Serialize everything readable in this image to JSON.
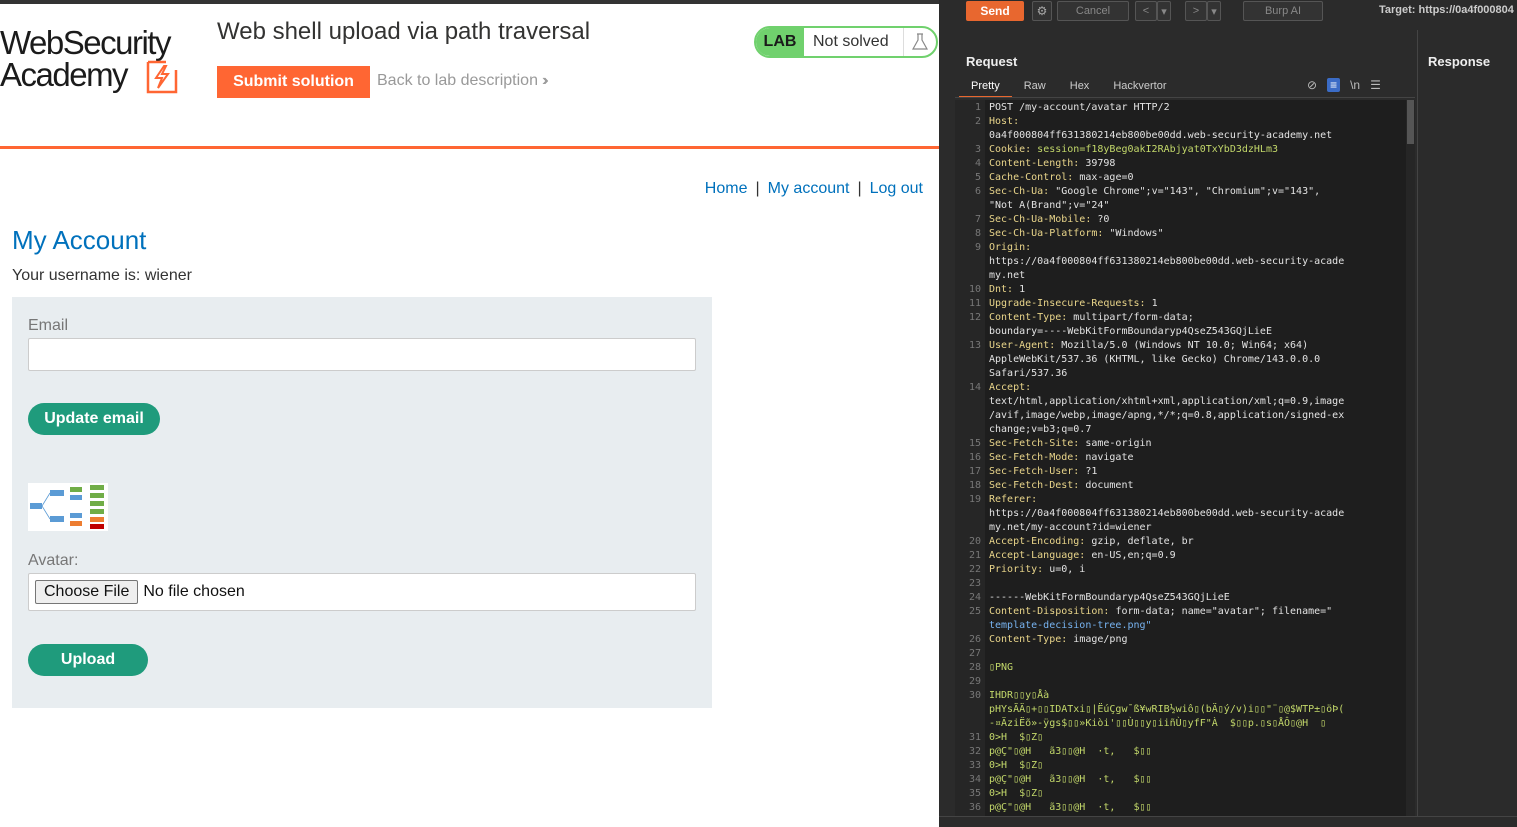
{
  "browser": {
    "logo": {
      "line1": "WebSecurity",
      "line2": "Academy"
    },
    "lab_title": "Web shell upload via path traversal",
    "submit_label": "Submit solution",
    "back_label": "Back to lab description",
    "lab_badge": {
      "tag": "LAB",
      "status": "Not solved"
    },
    "nav": {
      "home": "Home",
      "sep": "|",
      "account": "My account",
      "logout": "Log out"
    },
    "heading": "My Account",
    "username_line": "Your username is: wiener",
    "form": {
      "email_label": "Email",
      "email_value": "",
      "update_label": "Update email",
      "avatar_label": "Avatar:",
      "choose_file": "Choose File",
      "no_file": "No file chosen",
      "upload_label": "Upload"
    }
  },
  "burp": {
    "toolbar": {
      "send": "Send",
      "cancel": "Cancel",
      "burp_ai": "Burp AI",
      "target": "Target: https://0a4f000804"
    },
    "request_title": "Request",
    "response_title": "Response",
    "tabs": [
      "Pretty",
      "Raw",
      "Hex",
      "Hackvertor"
    ],
    "newline_toggle": "\\n",
    "lines": [
      {
        "n": "1",
        "k": "POST /my-account/avatar HTTP/2",
        "v": "",
        "kc": "hv"
      },
      {
        "n": "2",
        "k": "Host:",
        "v": "",
        "kc": "hk"
      },
      {
        "n": "",
        "k": "0a4f000804ff631380214eb800be00dd.web-security-academy.net",
        "v": "",
        "kc": "hv"
      },
      {
        "n": "3",
        "k": "Cookie: ",
        "v": "session=f18yBeg0akI2RAbjyat0TxYbD3dzHLm3",
        "kc": "hk",
        "vc": "gr"
      },
      {
        "n": "4",
        "k": "Content-Length:",
        "v": " 39798",
        "kc": "hk"
      },
      {
        "n": "5",
        "k": "Cache-Control:",
        "v": " max-age=0",
        "kc": "hk"
      },
      {
        "n": "6",
        "k": "Sec-Ch-Ua:",
        "v": " \"Google Chrome\";v=\"143\", \"Chromium\";v=\"143\",",
        "kc": "hk"
      },
      {
        "n": "",
        "k": "\"Not A(Brand\";v=\"24\"",
        "v": "",
        "kc": "hv"
      },
      {
        "n": "7",
        "k": "Sec-Ch-Ua-Mobile:",
        "v": " ?0",
        "kc": "hk"
      },
      {
        "n": "8",
        "k": "Sec-Ch-Ua-Platform:",
        "v": " \"Windows\"",
        "kc": "hk"
      },
      {
        "n": "9",
        "k": "Origin:",
        "v": "",
        "kc": "hk"
      },
      {
        "n": "",
        "k": "https://0a4f000804ff631380214eb800be00dd.web-security-acade",
        "v": "",
        "kc": "hv"
      },
      {
        "n": "",
        "k": "my.net",
        "v": "",
        "kc": "hv"
      },
      {
        "n": "10",
        "k": "Dnt:",
        "v": " 1",
        "kc": "hk"
      },
      {
        "n": "11",
        "k": "Upgrade-Insecure-Requests:",
        "v": " 1",
        "kc": "hk"
      },
      {
        "n": "12",
        "k": "Content-Type:",
        "v": " multipart/form-data;",
        "kc": "hk"
      },
      {
        "n": "",
        "k": "boundary=----WebKitFormBoundaryp4QseZ543GQjLieE",
        "v": "",
        "kc": "hv"
      },
      {
        "n": "13",
        "k": "User-Agent:",
        "v": " Mozilla/5.0 (Windows NT 10.0; Win64; x64)",
        "kc": "hk"
      },
      {
        "n": "",
        "k": "AppleWebKit/537.36 (KHTML, like Gecko) Chrome/143.0.0.0",
        "v": "",
        "kc": "hv"
      },
      {
        "n": "",
        "k": "Safari/537.36",
        "v": "",
        "kc": "hv"
      },
      {
        "n": "14",
        "k": "Accept:",
        "v": "",
        "kc": "hk"
      },
      {
        "n": "",
        "k": "text/html,application/xhtml+xml,application/xml;q=0.9,image",
        "v": "",
        "kc": "hv"
      },
      {
        "n": "",
        "k": "/avif,image/webp,image/apng,*/*;q=0.8,application/signed-ex",
        "v": "",
        "kc": "hv"
      },
      {
        "n": "",
        "k": "change;v=b3;q=0.7",
        "v": "",
        "kc": "hv"
      },
      {
        "n": "15",
        "k": "Sec-Fetch-Site:",
        "v": " same-origin",
        "kc": "hk"
      },
      {
        "n": "16",
        "k": "Sec-Fetch-Mode:",
        "v": " navigate",
        "kc": "hk"
      },
      {
        "n": "17",
        "k": "Sec-Fetch-User:",
        "v": " ?1",
        "kc": "hk"
      },
      {
        "n": "18",
        "k": "Sec-Fetch-Dest:",
        "v": " document",
        "kc": "hk"
      },
      {
        "n": "19",
        "k": "Referer:",
        "v": "",
        "kc": "hk"
      },
      {
        "n": "",
        "k": "https://0a4f000804ff631380214eb800be00dd.web-security-acade",
        "v": "",
        "kc": "hv"
      },
      {
        "n": "",
        "k": "my.net/my-account?id=wiener",
        "v": "",
        "kc": "hv"
      },
      {
        "n": "20",
        "k": "Accept-Encoding:",
        "v": " gzip, deflate, br",
        "kc": "hk"
      },
      {
        "n": "21",
        "k": "Accept-Language:",
        "v": " en-US,en;q=0.9",
        "kc": "hk"
      },
      {
        "n": "22",
        "k": "Priority:",
        "v": " u=0, i",
        "kc": "hk"
      },
      {
        "n": "23",
        "k": "",
        "v": "",
        "kc": "hv"
      },
      {
        "n": "24",
        "k": "------WebKitFormBoundaryp4QseZ543GQjLieE",
        "v": "",
        "kc": "hv"
      },
      {
        "n": "25",
        "k": "Content-Disposition:",
        "v": " form-data; name=\"avatar\"; filename=\"",
        "kc": "hk"
      },
      {
        "n": "",
        "k": "template-decision-tree.png\"",
        "v": "",
        "kc": "bl"
      },
      {
        "n": "26",
        "k": "Content-Type:",
        "v": " image/png",
        "kc": "hk"
      },
      {
        "n": "27",
        "k": "",
        "v": "",
        "kc": "hv"
      },
      {
        "n": "28",
        "k": "▯PNG",
        "v": "",
        "kc": "gr"
      },
      {
        "n": "29",
        "k": "",
        "v": "",
        "kc": "hv"
      },
      {
        "n": "30",
        "k": "IHDR▯▯y▯Åà",
        "v": "",
        "kc": "gr"
      },
      {
        "n": "",
        "k": "pHYsÃÄ▯+▯▯IDATxi▯|ËúÇgw¯ß¥wRIB½wiô▯(bÄ▯ý/v)i▯▯\"¨▯@$WTP±▯öÞ(",
        "v": "",
        "kc": "gr"
      },
      {
        "n": "",
        "k": "-¤ÄziËõ»-ÿgs$▯▯»Kiòi'▯▯Ù▯▯y▯iiñÙ▯yfF\"À  $▯▯p.▯s▯ÅÔ▯@H  ▯",
        "v": "",
        "kc": "gr"
      },
      {
        "n": "31",
        "k": "0>H  $▯Z▯",
        "v": "",
        "kc": "gr"
      },
      {
        "n": "32",
        "k": "p@Ç\"▯@H   ã3▯▯@H  ·t,   $▯▯",
        "v": "",
        "kc": "gr"
      },
      {
        "n": "33",
        "k": "0>H  $▯Z▯",
        "v": "",
        "kc": "gr"
      },
      {
        "n": "34",
        "k": "p@Ç\"▯@H   ã3▯▯@H  ·t,   $▯▯",
        "v": "",
        "kc": "gr"
      },
      {
        "n": "35",
        "k": "0>H  $▯Z▯",
        "v": "",
        "kc": "gr"
      },
      {
        "n": "36",
        "k": "p@Ç\"▯@H   ã3▯▯@H  ·t,   $▯▯",
        "v": "",
        "kc": "gr"
      }
    ]
  },
  "colors": {
    "brand_orange": "#ff6633",
    "link_blue": "#0071bc",
    "button_teal": "#1f9b7c",
    "lab_green": "#70d16d",
    "burp_send": "#e8672f"
  }
}
